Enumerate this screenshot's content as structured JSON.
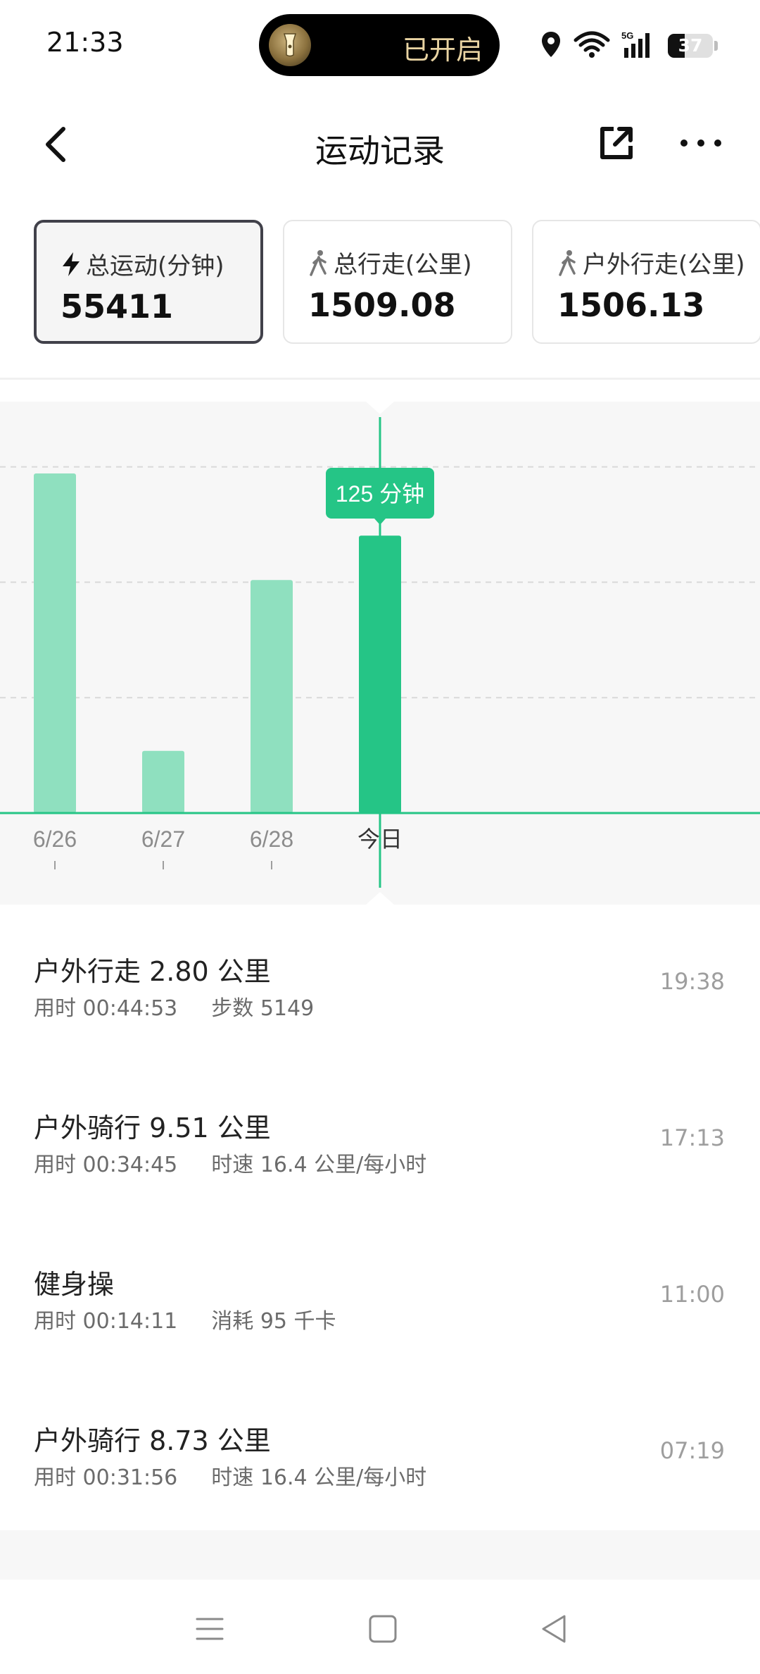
{
  "status_bar": {
    "time": "21:33",
    "pill_text": "已开启",
    "battery_level": "37",
    "battery_fraction": 0.37,
    "icons": [
      "flashlight-icon",
      "location-icon",
      "wifi-icon",
      "5g-signal-icon",
      "battery-icon"
    ]
  },
  "header": {
    "title": "运动记录",
    "back_icon": "chevron-left-icon",
    "share_icon": "share-external-icon",
    "more_icon": "more-dots-icon"
  },
  "stat_cards": [
    {
      "label": "总运动(分钟)",
      "value": "55411",
      "icon": "lightning-icon",
      "active": true
    },
    {
      "label": "总行走(公里)",
      "value": "1509.08",
      "icon": "walking-icon",
      "active": false
    },
    {
      "label": "户外行走(公里)",
      "value": "1506.13",
      "icon": "walking-icon",
      "active": false
    }
  ],
  "colors": {
    "accent": "#25c586",
    "bar_light": "#8fe0bf",
    "tooltip_bg": "#25c586",
    "text_secondary": "#6b6b6b"
  },
  "chart_data": {
    "type": "bar",
    "categories": [
      "6/26",
      "6/27",
      "6/28",
      "今日"
    ],
    "values": [
      153,
      28,
      105,
      125
    ],
    "ylim": [
      0,
      160
    ],
    "selected_index": 3,
    "tooltip": "125 分钟",
    "unit": "分钟",
    "grid": "dashed",
    "grid_lines": [
      52,
      104,
      156
    ]
  },
  "records": [
    {
      "title": "户外行走 2.80 公里",
      "duration": "用时 00:44:53",
      "extra": "步数 5149",
      "time": "19:38"
    },
    {
      "title": "户外骑行 9.51 公里",
      "duration": "用时 00:34:45",
      "extra": "时速 16.4 公里/每小时",
      "time": "17:13"
    },
    {
      "title": "健身操",
      "duration": "用时 00:14:11",
      "extra": "消耗 95 千卡",
      "time": "11:00"
    },
    {
      "title": "户外骑行 8.73 公里",
      "duration": "用时 00:31:56",
      "extra": "时速 16.4 公里/每小时",
      "time": "07:19"
    }
  ],
  "nav": {
    "icons": [
      "menu-icon",
      "home-square-icon",
      "back-triangle-icon"
    ]
  }
}
